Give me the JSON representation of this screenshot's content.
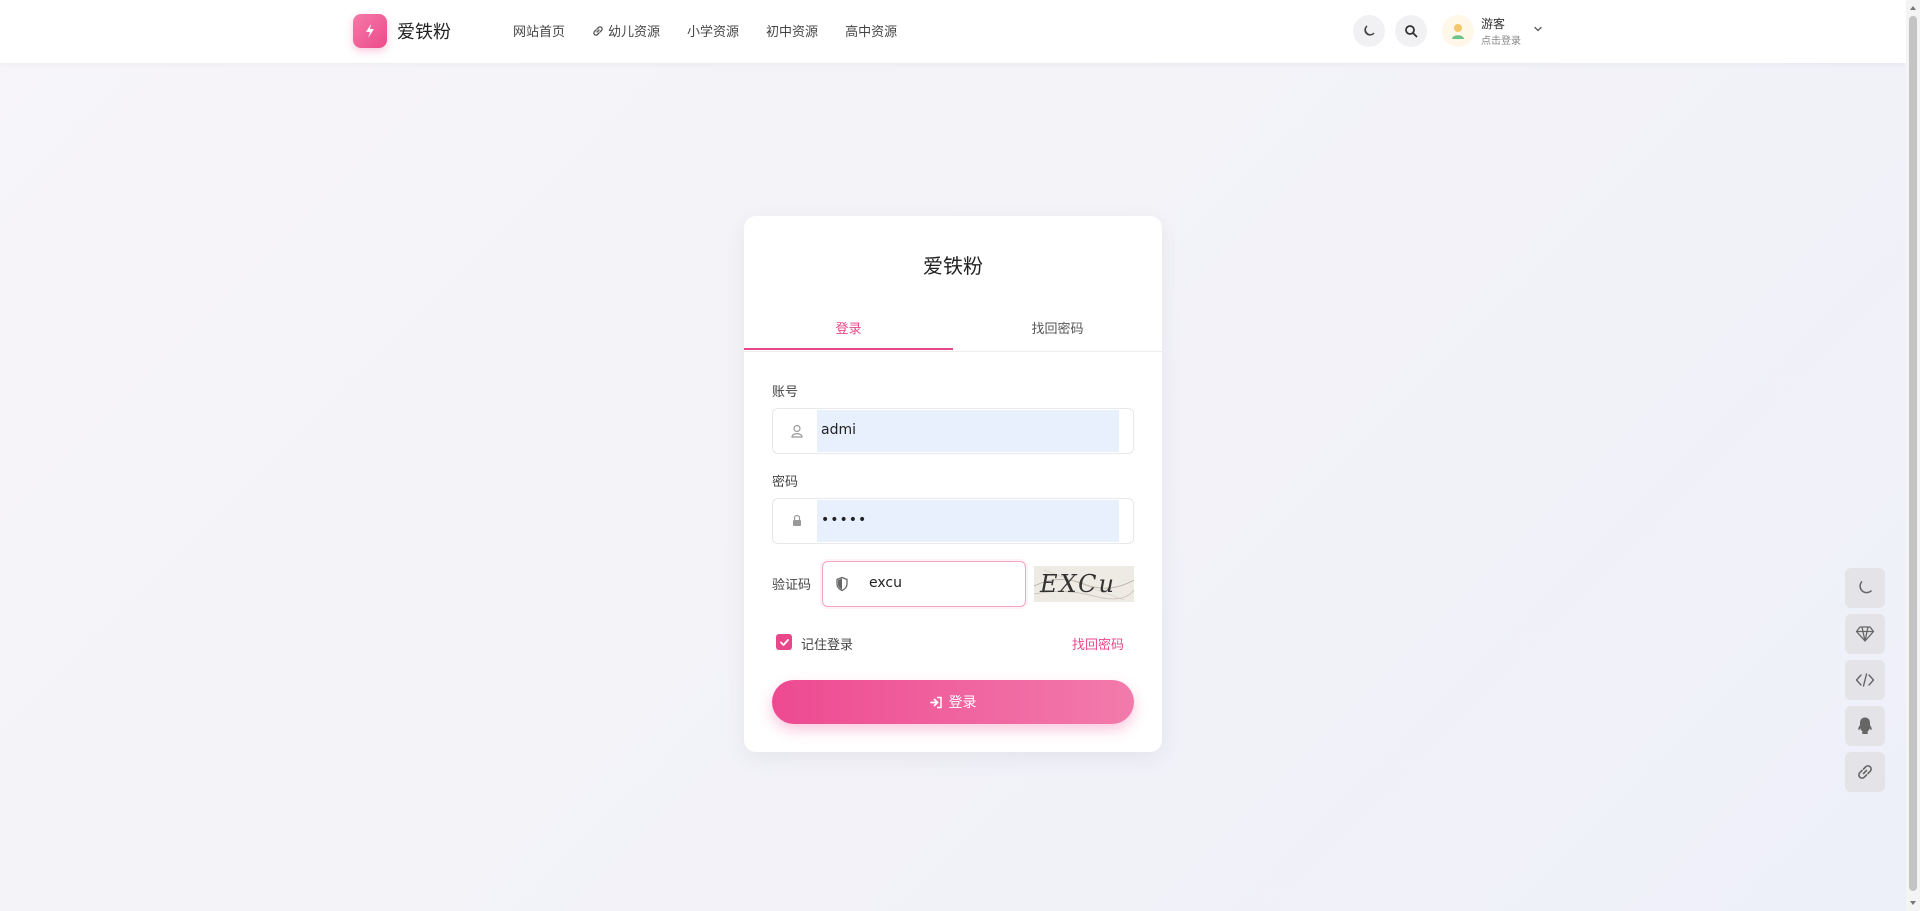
{
  "header": {
    "logo_text": "爱铁粉",
    "nav": [
      {
        "label": "网站首页",
        "icon": ""
      },
      {
        "label": "幼儿资源",
        "icon": "link-icon"
      },
      {
        "label": "小学资源",
        "icon": ""
      },
      {
        "label": "初中资源",
        "icon": ""
      },
      {
        "label": "高中资源",
        "icon": ""
      }
    ],
    "user_name": "游客",
    "user_sub": "点击登录"
  },
  "card": {
    "title": "爱铁粉",
    "tabs": [
      "登录",
      "找回密码"
    ],
    "account_label": "账号",
    "account_value": "admi",
    "password_label": "密码",
    "password_value": "•••••",
    "captcha_label": "验证码",
    "captcha_value": "excu",
    "captcha_image_text": "EXCu",
    "remember_label": "记住登录",
    "find_password_link": "找回密码",
    "login_button": "登录"
  },
  "colors": {
    "accent": "#e8488a",
    "autofill_bg": "#e8f0fe"
  }
}
